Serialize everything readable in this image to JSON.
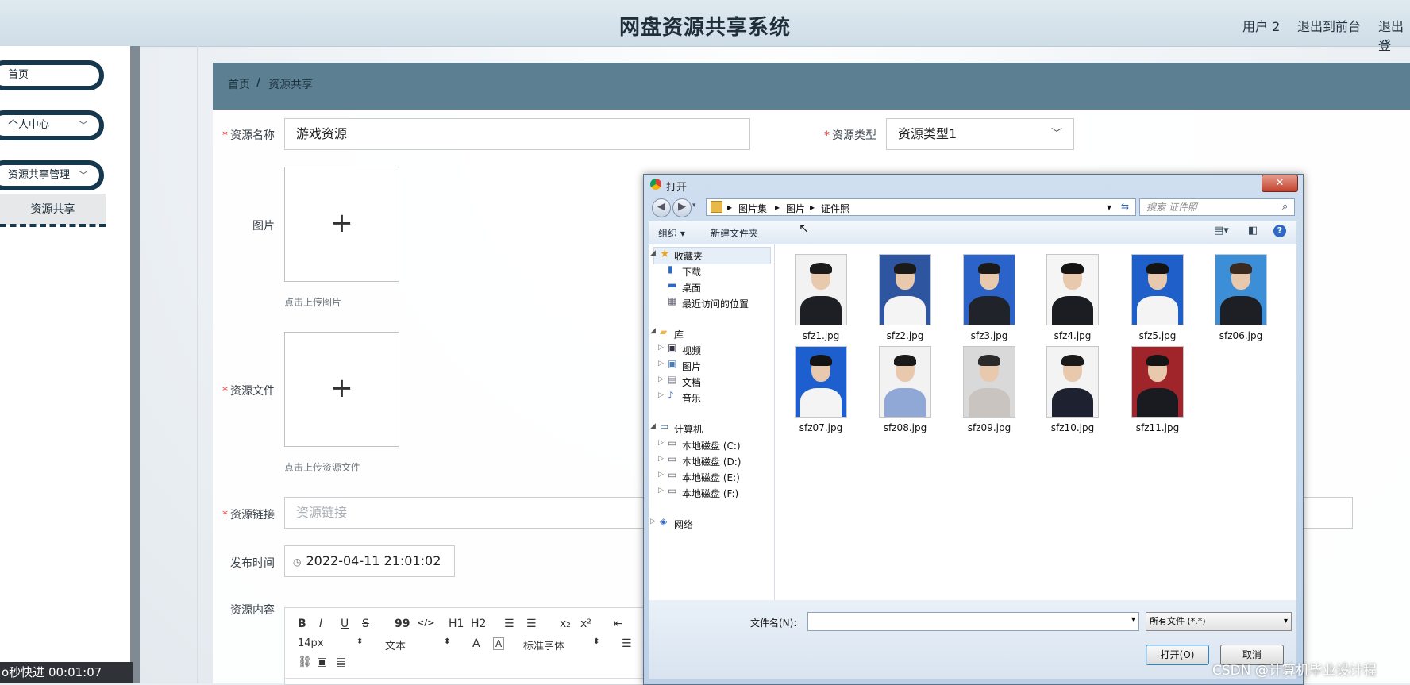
{
  "header": {
    "title": "网盘资源共享系统",
    "user": "用户 2",
    "back_front": "退出到前台",
    "logout": "退出登"
  },
  "sidebar": {
    "home": "首页",
    "personal": "个人中心",
    "resource_mgmt": "资源共享管理",
    "resource_share": "资源共享"
  },
  "timer": "o秒快进  00:01:07",
  "breadcrumb": {
    "home": "首页",
    "sep": "/",
    "current": "资源共享"
  },
  "form": {
    "name_label": "资源名称",
    "name_value": "游戏资源",
    "type_label": "资源类型",
    "type_value": "资源类型1",
    "image_label": "图片",
    "image_hint": "点击上传图片",
    "file_label": "资源文件",
    "file_hint": "点击上传资源文件",
    "link_label": "资源链接",
    "link_placeholder": "资源链接",
    "time_label": "发布时间",
    "time_value": "2022-04-11 21:01:02",
    "content_label": "资源内容",
    "plus": "+",
    "required": "*"
  },
  "editor": {
    "bold": "B",
    "italic": "I",
    "underline": "U",
    "strike": "S",
    "quote": "99",
    "code": "</>",
    "h1": "H1",
    "h2": "H2",
    "ol": "☰",
    "ul": "☰",
    "sub": "x₂",
    "sup": "x²",
    "indent": "⇤",
    "size": "14px",
    "family": "文本",
    "font_color": "A",
    "bg_color": "A",
    "font_style": "标准字体",
    "align": "☰"
  },
  "dialog": {
    "title": "打开",
    "close": "✕",
    "path": [
      "图片集",
      "图片",
      "证件照"
    ],
    "search_placeholder": "搜索 证件照",
    "organize": "组织 ▾",
    "new_folder": "新建文件夹",
    "nav": {
      "favorites": "收藏夹",
      "downloads": "下载",
      "desktop": "桌面",
      "recent": "最近访问的位置",
      "libraries": "库",
      "videos": "视频",
      "pictures": "图片",
      "documents": "文档",
      "music": "音乐",
      "computer": "计算机",
      "disk_c": "本地磁盘 (C:)",
      "disk_d": "本地磁盘 (D:)",
      "disk_e": "本地磁盘 (E:)",
      "disk_f": "本地磁盘 (F:)",
      "network": "网络"
    },
    "files": [
      {
        "name": "sfz1.jpg",
        "bg": "#f2f2f2",
        "cloth": "#1d1f24",
        "hair": "#1a1a1a"
      },
      {
        "name": "sfz2.jpg",
        "bg": "#2e56a0",
        "cloth": "#f4f4f4",
        "hair": "#1a1a1a"
      },
      {
        "name": "sfz3.jpg",
        "bg": "#2b63c9",
        "cloth": "#20232a",
        "hair": "#1a1a1a"
      },
      {
        "name": "sfz4.jpg",
        "bg": "#f5f5f5",
        "cloth": "#1b1d22",
        "hair": "#141414"
      },
      {
        "name": "sfz5.jpg",
        "bg": "#1f5fc9",
        "cloth": "#f4f4f4",
        "hair": "#141414"
      },
      {
        "name": "sfz06.jpg",
        "bg": "#3c8fd6",
        "cloth": "#1d1f24",
        "hair": "#3a2a20"
      },
      {
        "name": "sfz07.jpg",
        "bg": "#1e5fd0",
        "cloth": "#f4f4f4",
        "hair": "#141414"
      },
      {
        "name": "sfz08.jpg",
        "bg": "#f2f2f2",
        "cloth": "#8fa8d6",
        "hair": "#1a1a1a"
      },
      {
        "name": "sfz09.jpg",
        "bg": "#d9d9d9",
        "cloth": "#c9c4c0",
        "hair": "#2a2a2a"
      },
      {
        "name": "sfz10.jpg",
        "bg": "#f3f3f3",
        "cloth": "#1e2230",
        "hair": "#1a1a1a"
      },
      {
        "name": "sfz11.jpg",
        "bg": "#a0252b",
        "cloth": "#191b20",
        "hair": "#151515"
      }
    ],
    "filename_label": "文件名(N):",
    "filename_value": "",
    "filetype": "所有文件 (*.*)",
    "open_btn": "打开(O)",
    "cancel_btn": "取消"
  },
  "watermark": "CSDN @计算机毕业设计程"
}
